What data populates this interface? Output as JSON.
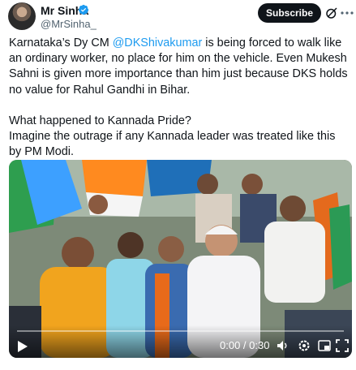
{
  "author": {
    "name": "Mr Sinha",
    "handle": "@MrSinha_"
  },
  "header": {
    "subscribe_label": "Subscribe"
  },
  "tweet": {
    "para1_pre": "Karnataka’s Dy CM ",
    "mention": "@DKShivakumar",
    "para1_post": " is being forced to walk like an ordinary worker, no place for him on the vehicle. Even Mukesh Sahni is given more importance than him just because DKS holds no value for Rahul Gandhi in Bihar.",
    "para2": "What happened to Kannada Pride?\nImagine the outrage if any Kannada leader was treated like this by PM Modi."
  },
  "video": {
    "time": "0:00 / 0:30"
  },
  "colors": {
    "accent": "#1d9bf0",
    "verified": "#1d9bf0",
    "button_bg": "#0f1419"
  }
}
